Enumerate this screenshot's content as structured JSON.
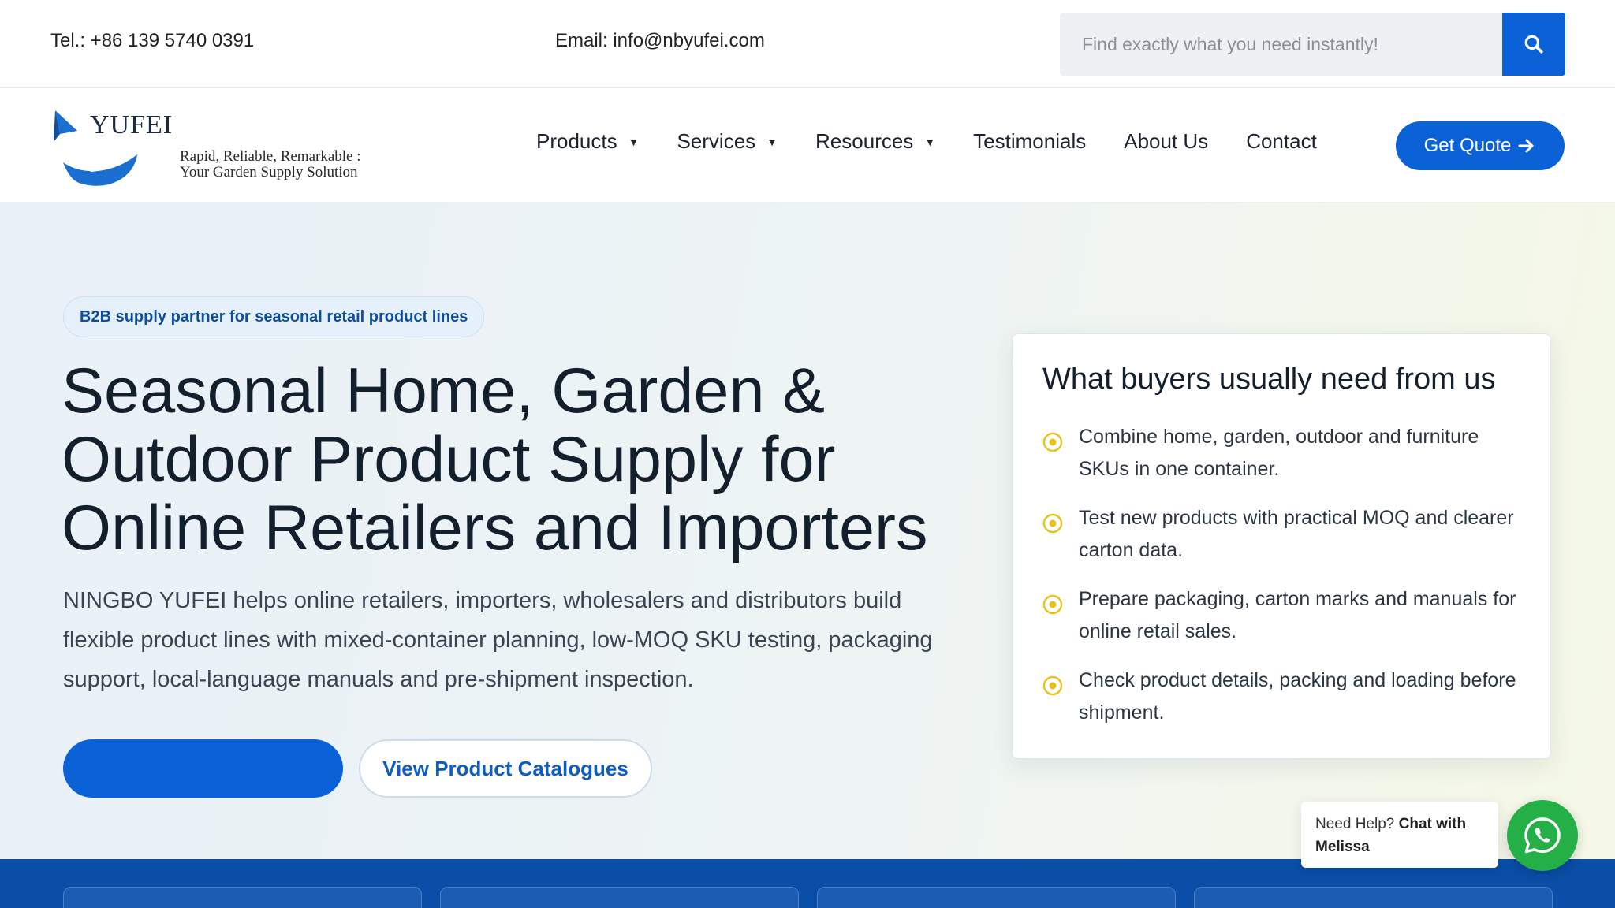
{
  "topbar": {
    "tel": "Tel.: +86 139 5740 0391",
    "email": "Email: info@nbyufei.com",
    "search_placeholder": "Find exactly what you need instantly!"
  },
  "header": {
    "logo": {
      "brand": "YUFEI",
      "tagline_line1": "Rapid, Reliable, Remarkable :",
      "tagline_line2": "Your Garden Supply Solution"
    },
    "nav": [
      {
        "label": "Products",
        "has_dropdown": true
      },
      {
        "label": "Services",
        "has_dropdown": true
      },
      {
        "label": "Resources",
        "has_dropdown": true
      },
      {
        "label": "Testimonials",
        "has_dropdown": false
      },
      {
        "label": "About Us",
        "has_dropdown": false
      },
      {
        "label": "Contact",
        "has_dropdown": false
      }
    ],
    "quote_button": "Get Quote"
  },
  "hero": {
    "pill": "B2B supply partner for seasonal retail product lines",
    "title": "Seasonal Home, Garden & Outdoor Product Supply for Online Retailers and Importers",
    "lead": "NINGBO YUFEI helps online retailers, importers, wholesalers and distributors build flexible product lines with mixed-container planning, low-MOQ SKU testing, packaging support, local-language manuals and pre-shipment inspection.",
    "primary_cta": "",
    "secondary_cta": "View Product Catalogues"
  },
  "card": {
    "title": "What buyers usually need from us",
    "items": [
      "Combine home, garden, outdoor and furniture SKUs in one container.",
      "Test new products with practical MOQ and clearer carton data.",
      "Prepare packaging, carton marks and manuals for online retail sales.",
      "Check product details, packing and loading before shipment."
    ]
  },
  "chat": {
    "prefix": "Need Help?",
    "bold": "Chat with Melissa"
  },
  "colors": {
    "primary": "#0a62d6",
    "strip": "#0a4ea8",
    "whatsapp": "#25b047",
    "bullet": "#e8c21a"
  },
  "icons": {
    "search": "search-icon",
    "arrow": "arrow-right-icon",
    "caret": "caret-down-icon",
    "bullet": "target-dot-icon",
    "whatsapp": "whatsapp-icon"
  }
}
